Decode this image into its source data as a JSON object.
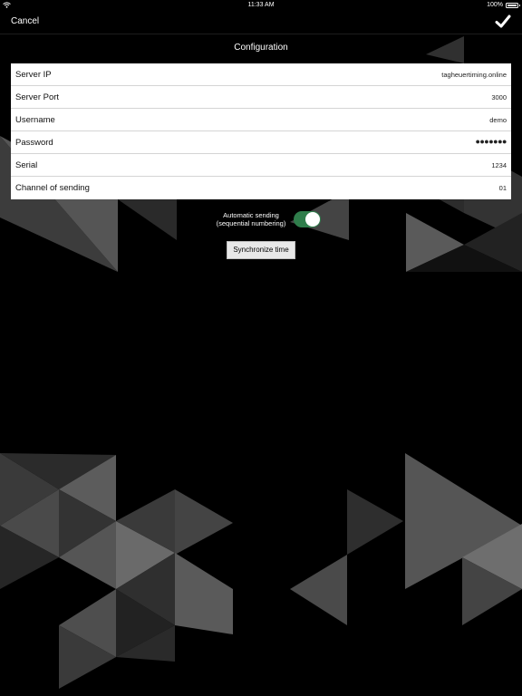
{
  "status_bar": {
    "time": "11:33 AM",
    "battery_text": "100%",
    "wifi_icon": "wifi-icon",
    "battery_icon": "battery-icon"
  },
  "nav": {
    "cancel_label": "Cancel",
    "confirm_icon": "checkmark-icon",
    "title": "Configuration"
  },
  "form": {
    "rows": [
      {
        "label": "Server IP",
        "value": "tagheuertiming.online"
      },
      {
        "label": "Server Port",
        "value": "3000"
      },
      {
        "label": "Username",
        "value": "demo"
      },
      {
        "label": "Password",
        "value": "●●●●●●●"
      },
      {
        "label": "Serial",
        "value": "1234"
      },
      {
        "label": "Channel of sending",
        "value": "01"
      }
    ]
  },
  "automatic_sending": {
    "label_line1": "Automatic sending",
    "label_line2": "(sequential numbering)",
    "enabled": true,
    "toggle_color": "#2f7d4b"
  },
  "sync_button": {
    "label": "Synchronize time"
  },
  "colors": {
    "background": "#000000",
    "form_background": "#ffffff",
    "toggle_on": "#2f7d4b"
  }
}
